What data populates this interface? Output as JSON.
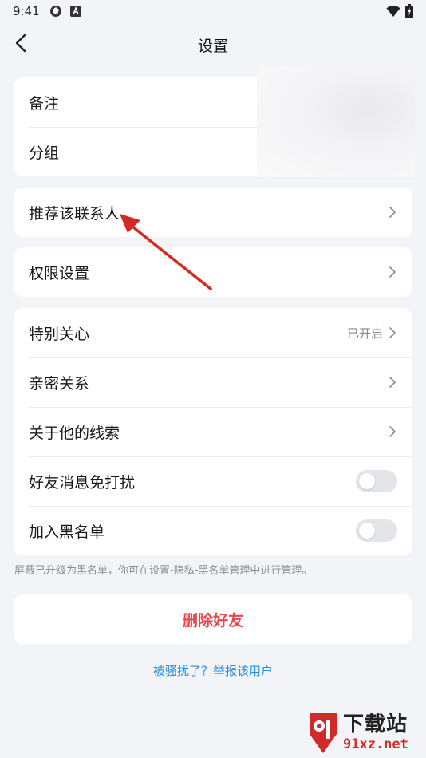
{
  "status_bar": {
    "time": "9:41",
    "left_icons": [
      "app-logo-icon",
      "a-letter-icon"
    ],
    "right_icons": [
      "wifi-icon",
      "battery-charging-icon"
    ]
  },
  "header": {
    "title": "设置",
    "back_icon": "chevron-left-icon"
  },
  "groups": {
    "profile": {
      "items": [
        {
          "label": "备注"
        },
        {
          "label": "分组"
        }
      ]
    },
    "recommend": {
      "label": "推荐该联系人"
    },
    "permissions": {
      "label": "权限设置"
    },
    "relations": {
      "special_care": {
        "label": "特别关心",
        "value": "已开启"
      },
      "intimate": {
        "label": "亲密关系"
      },
      "clues": {
        "label": "关于他的线索"
      },
      "mute": {
        "label": "好友消息免打扰",
        "enabled": false
      },
      "blacklist": {
        "label": "加入黑名单",
        "enabled": false
      }
    }
  },
  "hint": "屏蔽已升级为黑名单，你可在设置-隐私-黑名单管理中进行管理。",
  "delete_button": "删除好友",
  "report_link": "被骚扰了？举报该用户",
  "colors": {
    "background": "#f3f4f7",
    "card": "#ffffff",
    "danger": "#e5484d",
    "link": "#2d8bd8",
    "annotation_arrow": "#d42a22"
  },
  "watermark": {
    "title": "下载站",
    "subtitle": "91xz.net"
  }
}
